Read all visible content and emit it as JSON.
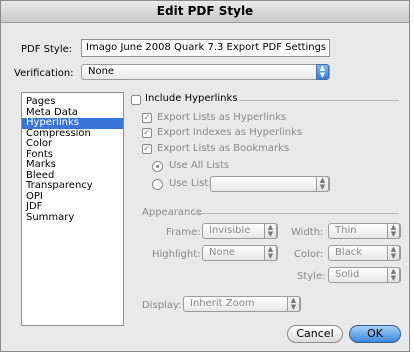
{
  "window": {
    "title": "Edit PDF Style"
  },
  "pdf_style": {
    "label": "PDF Style:",
    "value": "Imago June 2008 Quark 7.3 Export PDF Settings"
  },
  "verification": {
    "label": "Verification:",
    "value": "None"
  },
  "categories": [
    "Pages",
    "Meta Data",
    "Hyperlinks",
    "Compression",
    "Color",
    "Fonts",
    "Marks",
    "Bleed",
    "Transparency",
    "OPI",
    "JDF",
    "Summary"
  ],
  "selected_category": "Hyperlinks",
  "hyperlinks": {
    "include_label": "Include Hyperlinks",
    "export_lists": "Export Lists as Hyperlinks",
    "export_indexes": "Export Indexes as Hyperlinks",
    "export_bookmarks": "Export Lists as Bookmarks",
    "use_all_lists": "Use All Lists",
    "use_list": "Use List:",
    "use_list_value": ""
  },
  "appearance": {
    "header": "Appearance",
    "frame_label": "Frame:",
    "frame_value": "Invisible",
    "width_label": "Width:",
    "width_value": "Thin",
    "highlight_label": "Highlight:",
    "highlight_value": "None",
    "color_label": "Color:",
    "color_value": "Black",
    "style_label": "Style:",
    "style_value": "Solid"
  },
  "display": {
    "label": "Display:",
    "value": "Inherit Zoom"
  },
  "buttons": {
    "cancel": "Cancel",
    "ok": "OK"
  },
  "glyphs": {
    "check": "✓",
    "updown": "▲▼"
  }
}
